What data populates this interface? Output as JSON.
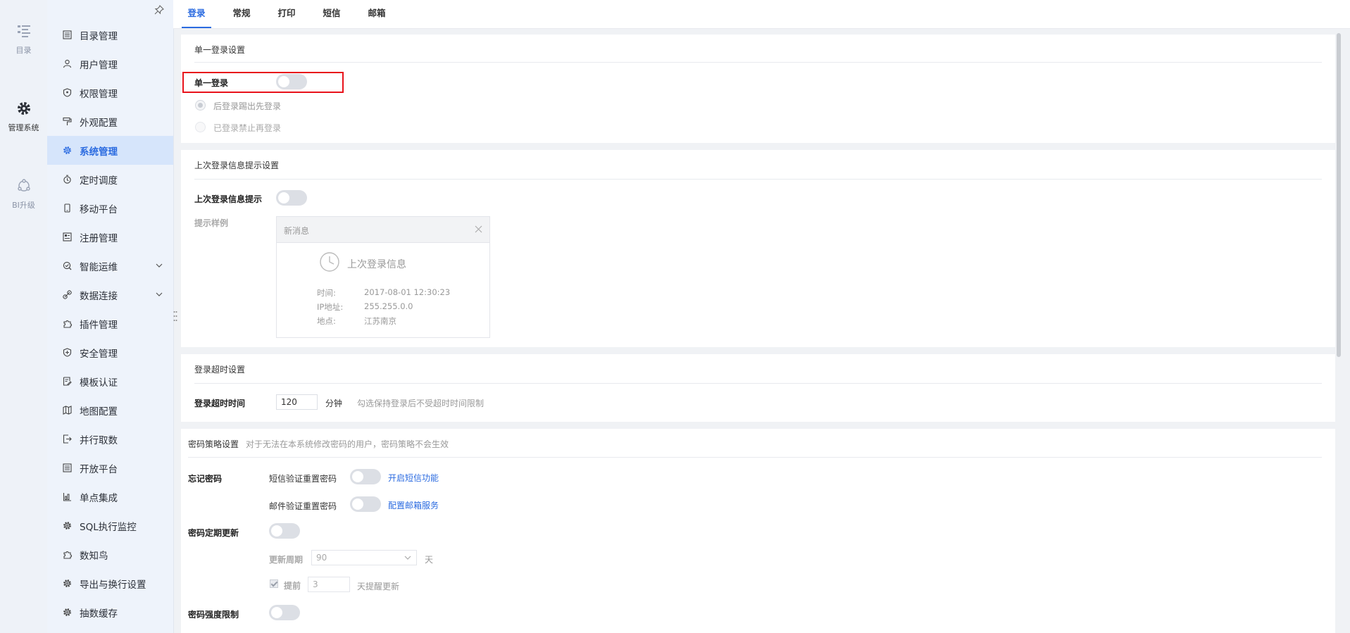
{
  "rail": {
    "items": [
      {
        "label": "目录",
        "icon": "catalog-list-icon"
      },
      {
        "label": "管理系统",
        "icon": "gear-icon"
      },
      {
        "label": "BI升级",
        "icon": "bi-upgrade-icon"
      }
    ]
  },
  "sidebar": {
    "items": [
      {
        "label": "目录管理",
        "icon": "list-icon"
      },
      {
        "label": "用户管理",
        "icon": "user-icon"
      },
      {
        "label": "权限管理",
        "icon": "shield-icon"
      },
      {
        "label": "外观配置",
        "icon": "paint-roller-icon"
      },
      {
        "label": "系统管理",
        "icon": "gear-icon",
        "active": true
      },
      {
        "label": "定时调度",
        "icon": "timer-icon"
      },
      {
        "label": "移动平台",
        "icon": "mobile-icon"
      },
      {
        "label": "注册管理",
        "icon": "register-icon"
      },
      {
        "label": "智能运维",
        "icon": "ops-icon",
        "expandable": true
      },
      {
        "label": "数据连接",
        "icon": "link-icon",
        "expandable": true
      },
      {
        "label": "插件管理",
        "icon": "plugin-icon"
      },
      {
        "label": "安全管理",
        "icon": "security-icon"
      },
      {
        "label": "模板认证",
        "icon": "template-icon"
      },
      {
        "label": "地图配置",
        "icon": "map-icon"
      },
      {
        "label": "并行取数",
        "icon": "export-icon"
      },
      {
        "label": "开放平台",
        "icon": "list-icon"
      },
      {
        "label": "单点集成",
        "icon": "chart-icon"
      },
      {
        "label": "SQL执行监控",
        "icon": "gear-icon"
      },
      {
        "label": "数知鸟",
        "icon": "plugin-icon"
      },
      {
        "label": "导出与换行设置",
        "icon": "gear-icon"
      },
      {
        "label": "抽数缓存",
        "icon": "gear-icon"
      }
    ]
  },
  "tabs": [
    {
      "label": "登录",
      "active": true
    },
    {
      "label": "常规"
    },
    {
      "label": "打印"
    },
    {
      "label": "短信"
    },
    {
      "label": "邮箱"
    }
  ],
  "single_login": {
    "section_title": "单一登录设置",
    "toggle_label": "单一登录",
    "option1": "后登录踢出先登录",
    "option2": "已登录禁止再登录"
  },
  "last_login": {
    "section_title": "上次登录信息提示设置",
    "toggle_label": "上次登录信息提示",
    "sample_label": "提示样例",
    "card": {
      "head": "新消息",
      "title": "上次登录信息",
      "time_key": "时间:",
      "time_val": "2017-08-01 12:30:23",
      "ip_key": "IP地址:",
      "ip_val": "255.255.0.0",
      "place_key": "地点:",
      "place_val": "江苏南京"
    }
  },
  "timeout": {
    "section_title": "登录超时设置",
    "label": "登录超时时间",
    "value": "120",
    "unit": "分钟",
    "hint": "勾选保持登录后不受超时时间限制"
  },
  "password": {
    "section_title": "密码策略设置",
    "section_hint": "对于无法在本系统修改密码的用户，密码策略不会生效",
    "forgot_label": "忘记密码",
    "sms_reset": "短信验证重置密码",
    "sms_link": "开启短信功能",
    "mail_reset": "邮件验证重置密码",
    "mail_link": "配置邮箱服务",
    "periodic_label": "密码定期更新",
    "period_label": "更新周期",
    "period_value": "90",
    "period_unit": "天",
    "remind_label": "提前",
    "remind_value": "3",
    "remind_unit": "天提醒更新",
    "strength_label": "密码强度限制"
  }
}
